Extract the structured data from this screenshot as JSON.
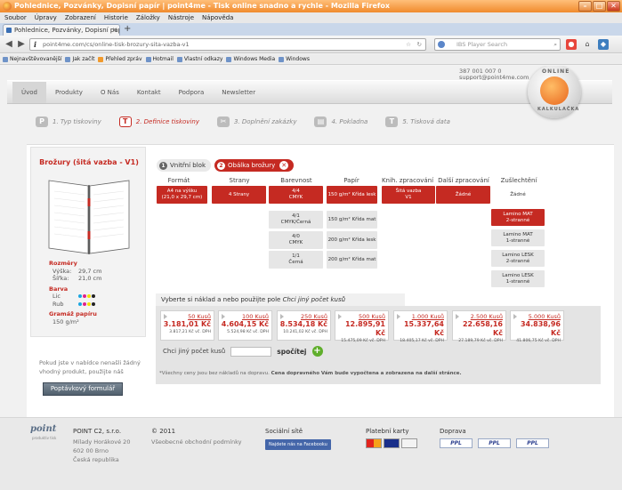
{
  "window": {
    "title": "Pohlednice, Pozvánky, Dopisní papír | point4me - Tisk online snadno a rychle - Mozilla Firefox"
  },
  "menu": [
    "Soubor",
    "Úpravy",
    "Zobrazení",
    "Historie",
    "Záložky",
    "Nástroje",
    "Nápověda"
  ],
  "tab": {
    "label": "Pohlednice, Pozvánky, Dopisní papír | point4...",
    "new_tab": "+"
  },
  "nav": {
    "url": "point4me.com/cs/online-tisk-brozury-sita-vazba-v1",
    "search_placeholder": "IBS Player Search"
  },
  "bookmarks": [
    "Nejnavštěvovanější",
    "Jak začít",
    "Přehled zpráv",
    "Hotmail",
    "Vlastní odkazy",
    "Windows Media",
    "Windows"
  ],
  "page": {
    "contact": {
      "phone": "387 001 007 0",
      "email": "support@point4me.com"
    },
    "main_nav": [
      "Úvod",
      "Produkty",
      "O Nás",
      "Kontakt",
      "Podpora",
      "Newsletter"
    ],
    "badge": {
      "top": "ONLINE",
      "bottom": "KALKULAČKA"
    },
    "steps": [
      {
        "icon": "P",
        "label": "1. Typ tiskoviny"
      },
      {
        "icon": "T",
        "label": "2. Definice tiskoviny"
      },
      {
        "icon": "✂",
        "label": "3. Doplnění zakázky"
      },
      {
        "icon": "▤",
        "label": "4. Pokladna"
      },
      {
        "icon": "T",
        "label": "5. Tisková data"
      }
    ],
    "product": {
      "title": "Brožury (šitá vazba - V1)",
      "dims_label": "Rozměry",
      "height_label": "Výška:",
      "height": "29,7 cm",
      "width_label": "Šířka:",
      "width": "21,0 cm",
      "color_label": "Barva",
      "face_label": "Lic",
      "back_label": "Rub",
      "weight_label": "Gramáž papíru",
      "weight": "150  g/m²"
    },
    "subtabs": {
      "inner": {
        "n": "1",
        "label": "Vnitřní blok"
      },
      "cover": {
        "n": "2",
        "label": "Obálka brožury",
        "close": "✕"
      }
    },
    "columns": {
      "format": {
        "head": "Formát",
        "opts": [
          "A4 na výšku\n(21,0 x 29,7 cm)"
        ]
      },
      "pages": {
        "head": "Strany",
        "opts": [
          "4 Strany"
        ]
      },
      "color": {
        "head": "Barevnost",
        "opts": [
          "4/4\nCMYK",
          "4/1\nCMYK/Černá",
          "4/0\nCMYK",
          "1/1\nČerná"
        ]
      },
      "paper": {
        "head": "Papír",
        "opts": [
          "150 g/m² Křída lesk",
          "150 g/m² Křída mat",
          "200 g/m² Křída lesk",
          "200 g/m² Křída mat"
        ]
      },
      "binding": {
        "head": "Knih. zpracování",
        "opts": [
          "Šitá vazba\nV1"
        ]
      },
      "further": {
        "head": "Další zpracování",
        "opts": [
          "Žádné"
        ]
      },
      "finishing": {
        "head": "Zušlechtění",
        "opts": [
          "Žádné",
          "Lamino MAT\n2-stranné",
          "Lamino MAT\n1-stranné",
          "Lamino LESK\n2-stranné",
          "Lamino LESK\n1-stranné"
        ]
      }
    },
    "chooser": {
      "text": "Vyberte si náklad a nebo použijte pole",
      "em": "Chci jiný počet kusů"
    },
    "quantities": [
      {
        "q": "50 Kusů",
        "p": "3.181,01 Kč",
        "v": "3.817,21 Kč vč. DPH"
      },
      {
        "q": "100 Kusů",
        "p": "4.604,15 Kč",
        "v": "5.524,98 Kč vč. DPH"
      },
      {
        "q": "250 Kusů",
        "p": "8.534,18 Kč",
        "v": "10.241,02 Kč vč. DPH"
      },
      {
        "q": "500 Kusů",
        "p": "12.895,91 Kč",
        "v": "15.475,09 Kč vč. DPH"
      },
      {
        "q": "1.000 Kusů",
        "p": "15.337,64 Kč",
        "v": "18.405,17 Kč vč. DPH"
      },
      {
        "q": "2.500 Kusů",
        "p": "22.658,16 Kč",
        "v": "27.189,79 Kč vč. DPH"
      },
      {
        "q": "5.000 Kusů",
        "p": "34.838,96 Kč",
        "v": "41.806,75 Kč vč. DPH"
      }
    ],
    "custom": {
      "label": "Chci jiný počet kusů",
      "go": "spočítej",
      "plus": "+"
    },
    "note": {
      "text": "*Všechny ceny jsou bez nákladů na dopravu.",
      "bold": "Cena dopravného Vám bude vypočtena a zobrazena na další stránce."
    },
    "inquiry": {
      "text": "Pokud jste v nabídce nenašli žádný vhodný produkt, použijte náš",
      "button": "Poptávkový formulář"
    }
  },
  "footer": {
    "logo": "point",
    "logo_sub": "produktiv tisk",
    "company": {
      "name": "POINT C2, s.r.o.",
      "street": "Mílady Horákové 20",
      "city": "602 00 Brno",
      "country": "Česká republika"
    },
    "copyright": "© 2011",
    "terms": "Všeobecné obchodní podmínky",
    "social": {
      "head": "Sociální sítě",
      "button": "Najdete nás na Facebooku"
    },
    "cards": {
      "head": "Platební karty"
    },
    "shipping": {
      "head": "Doprava",
      "carriers": [
        "PPL",
        "PPL",
        "PPL"
      ]
    }
  }
}
